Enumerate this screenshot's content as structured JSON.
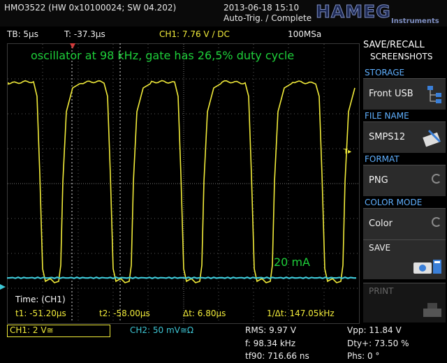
{
  "header": {
    "model": "HMO3522 (HW 0x10100024; SW 04.202)",
    "datetime": "2013-06-18 15:10",
    "trigger_state": "Auto-Trig. / Complete",
    "logo": "HAMEG",
    "logo_sub": "Instruments"
  },
  "status": {
    "timebase": "TB: 5µs",
    "trigger_time": "T: -37.3µs",
    "ch1_trigger": "CH1: 7.76 V ∕ DC",
    "sample_rate": "100MSa"
  },
  "screen": {
    "annotation_top": "oscillator at 98 kHz, gate has 26,5% duty cycle",
    "annotation_current": "20 mA",
    "trigger_marker": "T▸",
    "time_label": "Time: (CH1)",
    "t1": "t1: -51.20µs",
    "t2": "t2: -58.00µs",
    "dt": "Δt: 6.80µs",
    "inv_dt": "1/Δt: 147.05kHz"
  },
  "sidebar": {
    "title1": "SAVE/RECALL",
    "title2": "SCREENSHOTS",
    "storage_head": "STORAGE",
    "storage_value": "Front USB",
    "filename_head": "FILE NAME",
    "filename_value": "SMPS12",
    "format_head": "FORMAT",
    "format_value": "PNG",
    "color_head": "COLOR MODE",
    "color_value": "Color",
    "save_label": "SAVE",
    "print_label": "PRINT"
  },
  "bottom": {
    "ch1": "CH1: 2 V≅",
    "ch2": "CH2: 50 mV≅Ω",
    "rms": "RMS: 9.97 V",
    "freq": "f: 98.34 kHz",
    "tf90": "tf90: 716.66 ns",
    "vpp": "Vpp: 11.84 V",
    "dty": "Dty+: 73.50 %",
    "phs": "Phs: 0 °"
  },
  "colors": {
    "ch1": "#f2ec3a",
    "ch2": "#3ec7d6",
    "annotation": "#1ed03a",
    "menu_head": "#5fb0ff"
  }
}
